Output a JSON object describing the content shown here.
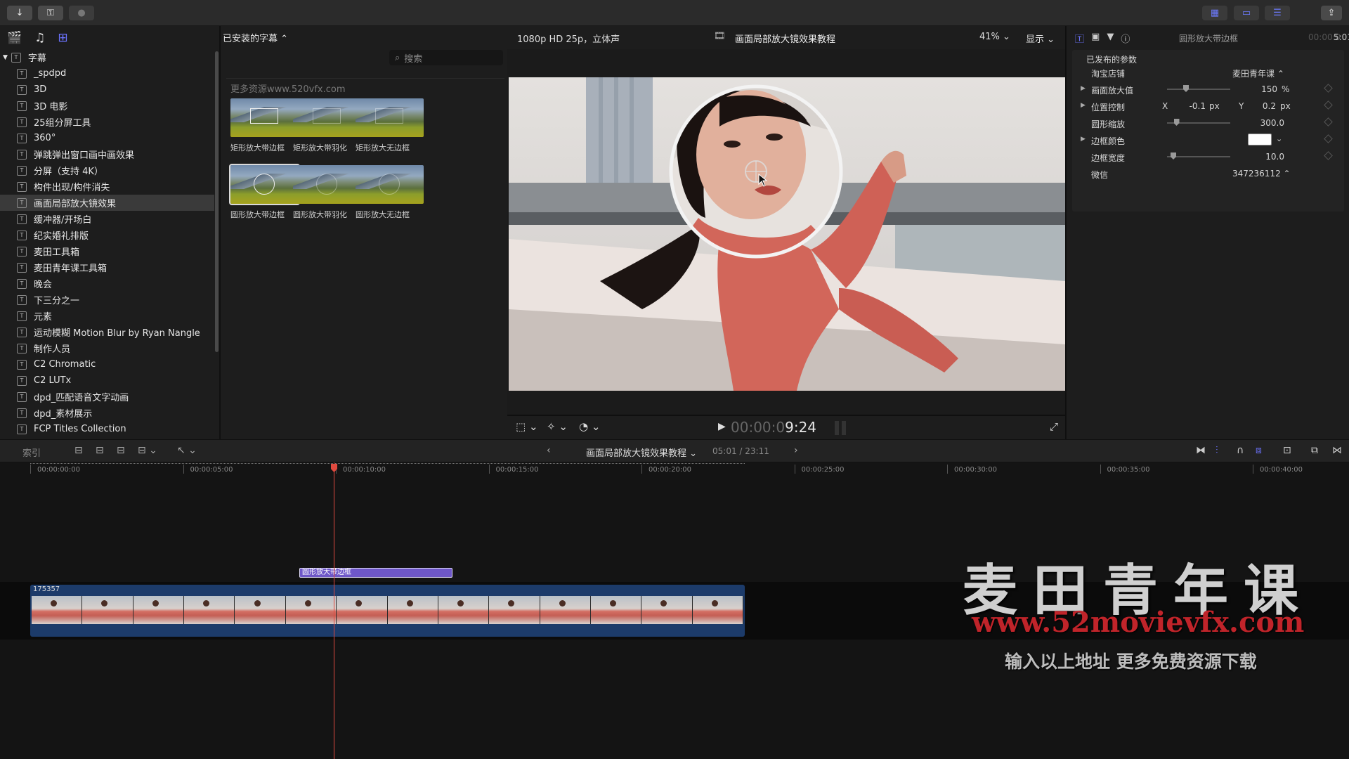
{
  "toolbar": {
    "import_icon": "download-arrow",
    "keywords_icon": "key",
    "bg_tasks_icon": "circle",
    "layout_icons": [
      "grid",
      "filmstrip",
      "sliders"
    ],
    "share_icon": "share"
  },
  "sidebar": {
    "root": "字幕",
    "items": [
      "_spdpd",
      "3D",
      "3D 电影",
      "25组分屏工具",
      "360°",
      "弹跳弹出窗口画中画效果",
      "分屏（支持 4K）",
      "构件出现/构件消失",
      "画面局部放大镜效果",
      "缓冲器/开场白",
      "纪实婚礼排版",
      "麦田工具箱",
      "麦田青年课工具箱",
      "晚会",
      "下三分之一",
      "元素",
      "运动模糊 Motion Blur by Ryan Nangle",
      "制作人员",
      "C2 Chromatic",
      "C2 LUTx",
      "dpd_匹配语音文字动画",
      "dpd_素材展示",
      "FCP Titles Collection"
    ],
    "selected_index": 8
  },
  "browser": {
    "header": "已安装的字幕 ⌃",
    "search_placeholder": "搜索",
    "more_text": "更多资源www.520vfx.com",
    "thumbs": [
      "矩形放大带边框",
      "矩形放大带羽化",
      "矩形放大无边框",
      "圆形放大带边框",
      "圆形放大带羽化",
      "圆形放大无边框"
    ],
    "selected_thumb": 3
  },
  "viewer": {
    "format": "1080p HD 25p，立体声",
    "title": "画面局部放大镜效果教程",
    "zoom": "41%",
    "display_label": "显示",
    "timecode_dim": "00:00:0",
    "timecode": "9:24"
  },
  "inspector": {
    "title": "圆形放大带边框",
    "duration": "5:01",
    "section": "已发布的参数",
    "rows": {
      "shop_label": "淘宝店铺",
      "shop_value": "麦田青年课 ⌃",
      "magnify_label": "画面放大值",
      "magnify_value": "150",
      "magnify_unit": "%",
      "position_label": "位置控制",
      "pos_x_label": "X",
      "pos_x": "-0.1",
      "pos_y_label": "Y",
      "pos_y": "0.2",
      "pos_unit": "px",
      "circle_scale_label": "圆形缩放",
      "circle_scale_value": "300.0",
      "border_color_label": "边框颜色",
      "border_width_label": "边框宽度",
      "border_width_value": "10.0",
      "wechat_label": "微信",
      "wechat_value": "347236112 ⌃"
    },
    "magnify_level": 0.3,
    "circle_scale_level": 0.15,
    "border_width_level": 0.1
  },
  "timeline": {
    "index_label": "索引",
    "project": "画面局部放大镜效果教程",
    "duration": "05:01 / 23:11",
    "ticks": [
      "00:00:00:00",
      "00:00:05:00",
      "00:00:10:00",
      "00:00:15:00",
      "00:00:20:00",
      "00:00:25:00",
      "00:00:30:00",
      "00:00:35:00",
      "00:00:40:00"
    ],
    "title_clip": "圆形放大带边框",
    "video_clip": "175357"
  },
  "watermark": {
    "line1": "麦田青年课",
    "line2": "www.52movievfx.com",
    "line3": "输入以上地址 更多免费资源下载"
  },
  "colors": {
    "accent": "#6c73ff",
    "playhead": "#e04a3f",
    "title_clip": "#6e57c8",
    "video_clip": "#1c3b6a",
    "watermark_red": "#c0242a"
  }
}
